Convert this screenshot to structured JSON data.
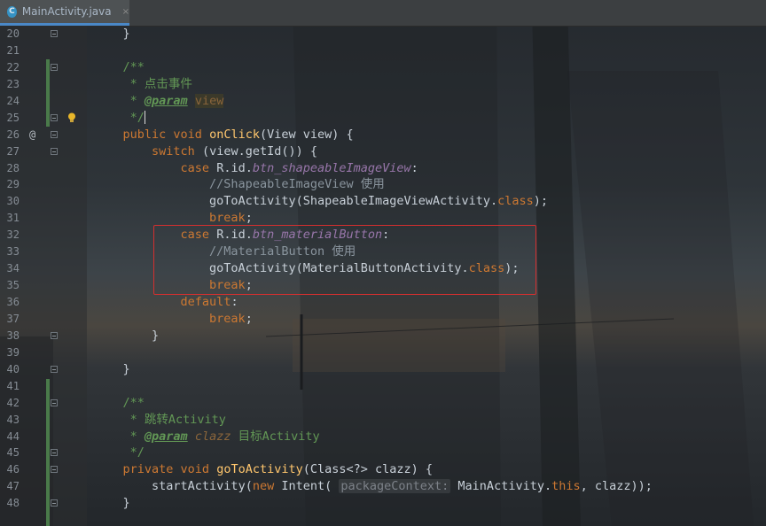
{
  "tab": {
    "icon_letter": "C",
    "filename": "MainActivity.java",
    "close_glyph": "×"
  },
  "lines": [
    {
      "n": "20",
      "text": "    }"
    },
    {
      "n": "21",
      "text": ""
    },
    {
      "n": "22",
      "text": "    /**"
    },
    {
      "n": "23",
      "text": "     * 点击事件"
    },
    {
      "n": "24",
      "text": "     * @param view"
    },
    {
      "n": "25",
      "text": "     */"
    },
    {
      "n": "26",
      "text": "    public void onClick(View view) {"
    },
    {
      "n": "27",
      "text": "        switch (view.getId()) {"
    },
    {
      "n": "28",
      "text": "            case R.id.btn_shapeableImageView:"
    },
    {
      "n": "29",
      "text": "                //ShapeableImageView 使用"
    },
    {
      "n": "30",
      "text": "                goToActivity(ShapeableImageViewActivity.class);"
    },
    {
      "n": "31",
      "text": "                break;"
    },
    {
      "n": "32",
      "text": "            case R.id.btn_materialButton:"
    },
    {
      "n": "33",
      "text": "                //MaterialButton 使用"
    },
    {
      "n": "34",
      "text": "                goToActivity(MaterialButtonActivity.class);"
    },
    {
      "n": "35",
      "text": "                break;"
    },
    {
      "n": "36",
      "text": "            default:"
    },
    {
      "n": "37",
      "text": "                break;"
    },
    {
      "n": "38",
      "text": "        }"
    },
    {
      "n": "39",
      "text": ""
    },
    {
      "n": "40",
      "text": "    }"
    },
    {
      "n": "41",
      "text": ""
    },
    {
      "n": "42",
      "text": "    /**"
    },
    {
      "n": "43",
      "text": "     * 跳转Activity"
    },
    {
      "n": "44",
      "text": "     * @param clazz 目标Activity"
    },
    {
      "n": "45",
      "text": "     */"
    },
    {
      "n": "46",
      "text": "    private void goToActivity(Class<?> clazz) {"
    },
    {
      "n": "47",
      "text": "        startActivity(new Intent( packageContext: MainActivity.this, clazz));"
    },
    {
      "n": "48",
      "text": "    }"
    }
  ],
  "tokens": {
    "t23": "点击事件",
    "at_param": "@param",
    "view_param": "view",
    "t26_kw": "public void ",
    "t26_fn": "onClick",
    "t26_rest": "(View view) {",
    "t27_kw": "switch",
    "t27_rest": " (view.getId()) {",
    "case_kw": "case",
    "rid": " R.id.",
    "f28": "btn_shapeableImageView",
    "c29": "//ShapeableImageView 使用",
    "t30a": "goToActivity(ShapeableImageViewActivity.",
    "class_kw": "class",
    "break_kw": "break",
    "f32": "btn_materialButton",
    "c33": "//MaterialButton 使用",
    "t34a": "goToActivity(MaterialButtonActivity.",
    "default_kw": "default",
    "t43": "跳转Activity",
    "clazz_param": "clazz",
    "t44_rest": "目标Activity",
    "t46_kw": "private void ",
    "t46_fn": "goToActivity",
    "t46_rest": "(Class<?> clazz) {",
    "t47_a": "startActivity(",
    "new_kw": "new",
    "t47_b": " Intent( ",
    "hint_pc": "packageContext:",
    "t47_c": " MainActivity.",
    "this_kw": "this",
    "t47_d": ", clazz));",
    "override_marker": "@"
  },
  "colors": {
    "keyword": "#cc7832",
    "function": "#ffc66d",
    "field": "#9876aa",
    "comment": "#8a959e",
    "doc": "#629755",
    "highlight_border": "#d32f2f"
  }
}
